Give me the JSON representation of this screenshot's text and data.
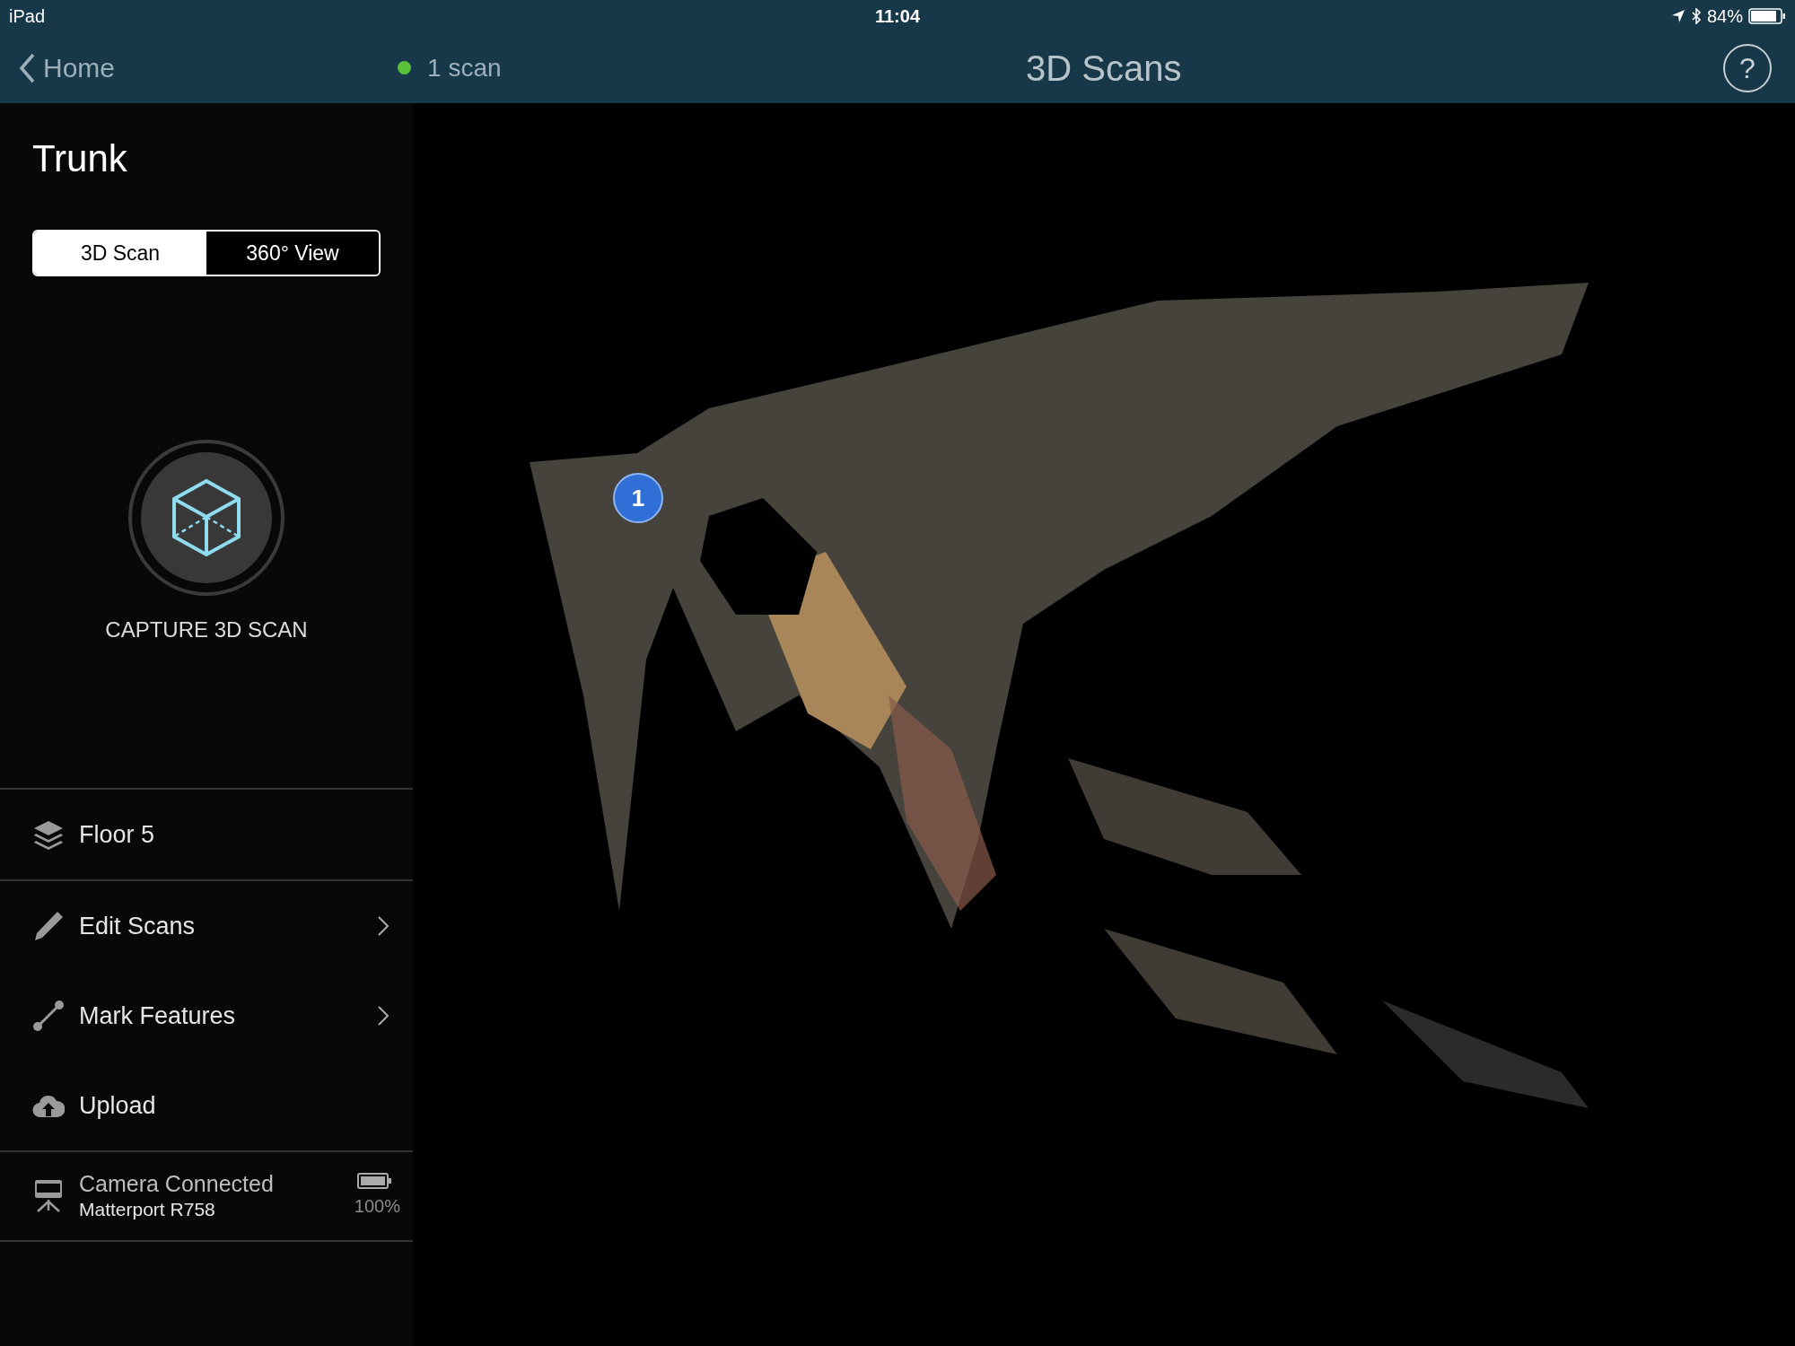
{
  "status_bar": {
    "device": "iPad",
    "time": "11:04",
    "battery": "84%"
  },
  "nav": {
    "back": "Home",
    "scan_count": "1 scan",
    "title": "3D Scans",
    "help": "?"
  },
  "sidebar": {
    "title": "Trunk",
    "segments": [
      {
        "label": "3D Scan",
        "selected": true
      },
      {
        "label": "360° View",
        "selected": false
      }
    ],
    "capture_label": "CAPTURE 3D SCAN",
    "sections": [
      [
        {
          "kind": "floor",
          "label": "Floor 5",
          "chevron": false
        }
      ],
      [
        {
          "kind": "edit",
          "label": "Edit Scans",
          "chevron": true
        },
        {
          "kind": "mark",
          "label": "Mark Features",
          "chevron": true
        },
        {
          "kind": "upload",
          "label": "Upload",
          "chevron": false
        }
      ]
    ],
    "camera": {
      "status": "Camera Connected",
      "model": "Matterport R758",
      "battery": "100%"
    }
  },
  "viewer": {
    "marker": "1"
  }
}
